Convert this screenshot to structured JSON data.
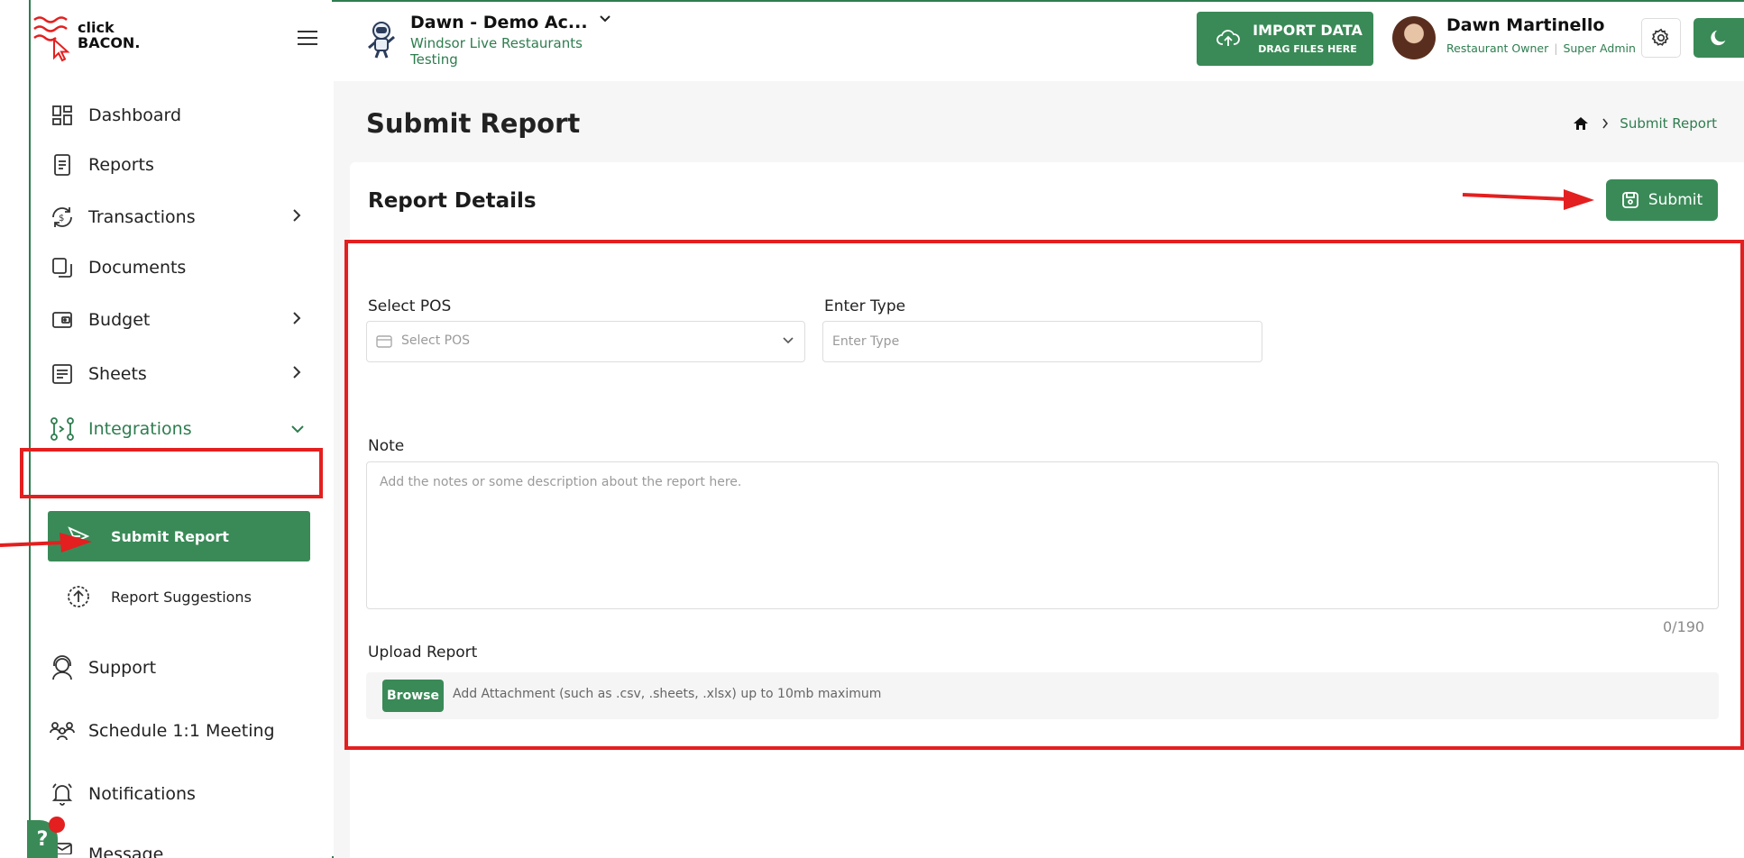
{
  "brand": {
    "line1": "click",
    "line2": "BACON."
  },
  "sidebar": {
    "items": [
      {
        "label": "Dashboard",
        "icon": "dashboard-icon"
      },
      {
        "label": "Reports",
        "icon": "reports-icon"
      },
      {
        "label": "Transactions",
        "icon": "transactions-icon"
      },
      {
        "label": "Documents",
        "icon": "documents-icon"
      },
      {
        "label": "Budget",
        "icon": "budget-icon"
      },
      {
        "label": "Sheets",
        "icon": "sheets-icon"
      },
      {
        "label": "Integrations",
        "icon": "integrations-icon"
      },
      {
        "label": "Support",
        "icon": "support-icon"
      },
      {
        "label": "Schedule 1:1 Meeting",
        "icon": "meeting-icon"
      },
      {
        "label": "Notifications",
        "icon": "bell-icon"
      },
      {
        "label": "Message",
        "icon": "message-icon"
      }
    ],
    "subitems": [
      {
        "label": "Submit Report",
        "icon": "send-icon"
      },
      {
        "label": "Report Suggestions",
        "icon": "upload-circle-icon"
      }
    ],
    "help_label": "?"
  },
  "header": {
    "account_name": "Dawn - Demo Ac...",
    "account_sub": "Windsor Live Restaurants Testing",
    "import_title": "IMPORT DATA",
    "import_sub": "DRAG FILES HERE",
    "user_name": "Dawn Martinello",
    "user_role": "Restaurant Owner",
    "user_role2": "Super Admin"
  },
  "page": {
    "title": "Submit Report",
    "breadcrumb_current": "Submit Report"
  },
  "form": {
    "card_title": "Report Details",
    "submit_label": "Submit",
    "pos_label": "Select POS",
    "pos_placeholder": "Select POS",
    "type_label": "Enter Type",
    "type_placeholder": "Enter Type",
    "note_label": "Note",
    "note_placeholder": "Add the notes or some description about the report here.",
    "counter": "0/190",
    "upload_label": "Upload Report",
    "browse_label": "Browse",
    "upload_hint": "Add Attachment (such as .csv, .sheets, .xlsx) up to 10mb maximum"
  },
  "colors": {
    "brand_green": "#3a8a57",
    "accent_text_green": "#2e7d4f",
    "annotation_red": "#e41f1f"
  }
}
